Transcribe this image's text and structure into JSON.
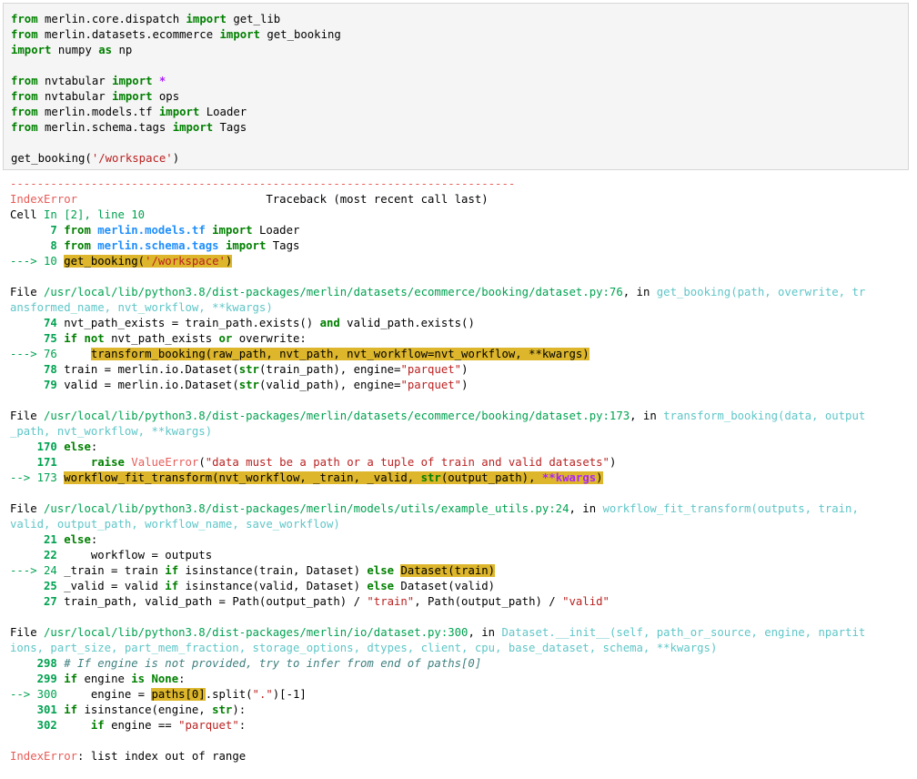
{
  "input_lines": [
    {
      "kind": "from",
      "module": "merlin.core.dispatch",
      "name": "get_lib"
    },
    {
      "kind": "from",
      "module": "merlin.datasets.ecommerce",
      "name": "get_booking"
    },
    {
      "kind": "import_as",
      "module": "numpy",
      "alias": "np"
    },
    {
      "kind": "blank"
    },
    {
      "kind": "from",
      "module": "nvtabular",
      "name": "*"
    },
    {
      "kind": "from",
      "module": "nvtabular",
      "name": "ops"
    },
    {
      "kind": "from",
      "module": "merlin.models.tf",
      "name": "Loader"
    },
    {
      "kind": "from",
      "module": "merlin.schema.tags",
      "name": "Tags"
    },
    {
      "kind": "blank"
    },
    {
      "kind": "call",
      "func": "get_booking(",
      "arg": "'/workspace'",
      "close": ")"
    }
  ],
  "keywords": {
    "from": "from",
    "import": "import",
    "as": "as"
  },
  "separator": "---------------------------------------------------------------------------",
  "error_type": "IndexError",
  "traceback_header": "Traceback (most recent call last)",
  "cell_ref": {
    "prefix": "Cell ",
    "cell": "In [2], line 10"
  },
  "frame0": {
    "l7": {
      "no": "      7",
      "kw_from": "from",
      "mod": "merlin.models.tf",
      "kw_import": "import",
      "name": "Loader"
    },
    "l8": {
      "no": "      8",
      "kw_from": "from",
      "mod": "merlin.schema.tags",
      "kw_import": "import",
      "name": "Tags"
    },
    "l10": {
      "arrow": "---> 10",
      "func": "get_booking(",
      "arg": "'/workspace'",
      "close": ")"
    }
  },
  "frame1": {
    "file_prefix": "File ",
    "path": "/usr/local/lib/python3.8/dist-packages/merlin/datasets/ecommerce/booking/dataset.py:76",
    "in_text": ", in ",
    "sig_line1": "get_booking(path, overwrite, tr",
    "sig_line2": "ansformed_name, nvt_workflow, **kwargs)",
    "lines": {
      "a": {
        "no": "     74",
        "code1": "nvt_path_exists = train_path.exists() ",
        "kw": "and",
        "code2": " valid_path.exists()"
      },
      "b": {
        "no": "     75",
        "kw1": "if",
        "kw2": "not",
        "code1": " nvt_path_exists ",
        "kw3": "or",
        "code2": " overwrite:"
      },
      "c": {
        "arrow": "---> 76",
        "indent": "    ",
        "code": "transform_booking(raw_path, nvt_path, nvt_workflow=nvt_workflow, **kwargs)"
      },
      "d": {
        "no": "     78",
        "code1": "train = merlin.io.Dataset(",
        "builtin": "str",
        "code2": "(train_path), engine=",
        "str": "\"parquet\"",
        "code3": ")"
      },
      "e": {
        "no": "     79",
        "code1": "valid = merlin.io.Dataset(",
        "builtin": "str",
        "code2": "(valid_path), engine=",
        "str": "\"parquet\"",
        "code3": ")"
      }
    }
  },
  "frame2": {
    "file_prefix": "File ",
    "path": "/usr/local/lib/python3.8/dist-packages/merlin/datasets/ecommerce/booking/dataset.py:173",
    "in_text": ", in ",
    "sig_line1": "transform_booking(data, output",
    "sig_line2": "_path, nvt_workflow, **kwargs)",
    "lines": {
      "a": {
        "no": "    170",
        "kw": "else",
        "code": ":"
      },
      "b": {
        "no": "    171",
        "indent": "    ",
        "kw": "raise",
        "exc": "ValueError",
        "code1": "(",
        "str": "\"data must be a path or a tuple of train and valid datasets\"",
        "code2": ")"
      },
      "c": {
        "arrow": "--> 173",
        "code1": "workflow_fit_transform(nvt_workflow, _train, _valid, ",
        "builtin": "str",
        "code2": "(output_path), ",
        "kw": "**kwargs",
        "code3": ")"
      }
    }
  },
  "frame3": {
    "file_prefix": "File ",
    "path": "/usr/local/lib/python3.8/dist-packages/merlin/models/utils/example_utils.py:24",
    "in_text": ", in ",
    "sig_line1": "workflow_fit_transform(outputs, train,",
    "sig_line2": "valid, output_path, workflow_name, save_workflow)",
    "lines": {
      "a": {
        "no": "     21",
        "kw": "else",
        "code": ":"
      },
      "b": {
        "no": "     22",
        "code": "    workflow = outputs"
      },
      "c": {
        "arrow": "---> 24",
        "code1": "_train = train ",
        "kw1": "if",
        "code2": " isinstance(train, Dataset) ",
        "kw2": "else",
        "code3": " ",
        "hl": "Dataset(train)"
      },
      "d": {
        "no": "     25",
        "code1": "_valid = valid ",
        "kw1": "if",
        "code2": " isinstance(valid, Dataset) ",
        "kw2": "else",
        "code3": " Dataset(valid)"
      },
      "e": {
        "no": "     27",
        "code1": "train_path, valid_path = Path(output_path) / ",
        "str1": "\"train\"",
        "code2": ", Path(output_path) / ",
        "str2": "\"valid\""
      }
    }
  },
  "frame4": {
    "file_prefix": "File ",
    "path": "/usr/local/lib/python3.8/dist-packages/merlin/io/dataset.py:300",
    "in_text": ", in ",
    "sig_line1": "Dataset.__init__(self, path_or_source, engine, npartit",
    "sig_line2": "ions, part_size, part_mem_fraction, storage_options, dtypes, client, cpu, base_dataset, schema, **kwargs)",
    "lines": {
      "a": {
        "no": "    298",
        "comment": "# If engine is not provided, try to infer from end of paths[0]"
      },
      "b": {
        "no": "    299",
        "kw1": "if",
        "code": " engine ",
        "kw2": "is",
        "kw3": "None",
        "colon": ":"
      },
      "c": {
        "arrow": "--> 300",
        "code1": "    engine = ",
        "hl": "paths[0]",
        "code2": ".split(",
        "str": "\".\"",
        "code3": ")[-1]"
      },
      "d": {
        "no": "    301",
        "kw": "if",
        "code": " isinstance(engine, ",
        "builtin": "str",
        "code2": "):"
      },
      "e": {
        "no": "    302",
        "indent": "    ",
        "kw": "if",
        "code": " engine == ",
        "str": "\"parquet\"",
        "code2": ":"
      }
    }
  },
  "final_error": {
    "type": "IndexError",
    "message": ": list index out of range"
  }
}
